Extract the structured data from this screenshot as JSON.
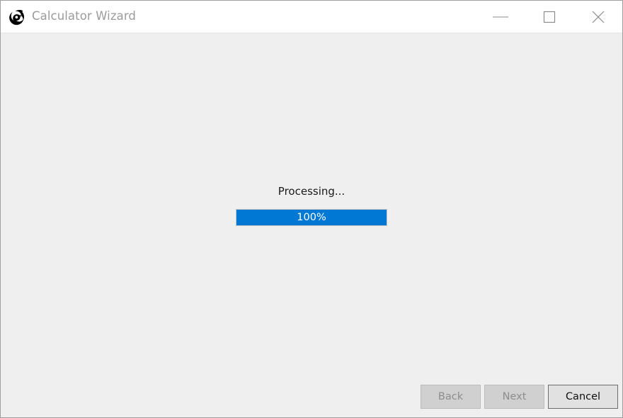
{
  "window": {
    "title": "Calculator Wizard",
    "app_icon": "cyclone-icon",
    "background_color": "#efefef",
    "titlebar_color": "#ffffff",
    "border_color": "#9e9e9e",
    "controls": [
      {
        "name": "minimize",
        "glyph": "minimize-icon",
        "label": "Minimize"
      },
      {
        "name": "maximize",
        "glyph": "maximize-icon",
        "label": "Maximize"
      },
      {
        "name": "close",
        "glyph": "close-icon",
        "label": "Close"
      }
    ]
  },
  "content": {
    "status_label": "Processing...",
    "progress": {
      "value_text": "100%",
      "percent": 100,
      "fill_color": "#0078d4",
      "track_color": "#e6e6e6",
      "text_color": "#ffffff"
    }
  },
  "footer": {
    "back_label": "Back",
    "next_label": "Next",
    "cancel_label": "Cancel",
    "back_enabled": false,
    "next_enabled": false,
    "cancel_enabled": true
  }
}
